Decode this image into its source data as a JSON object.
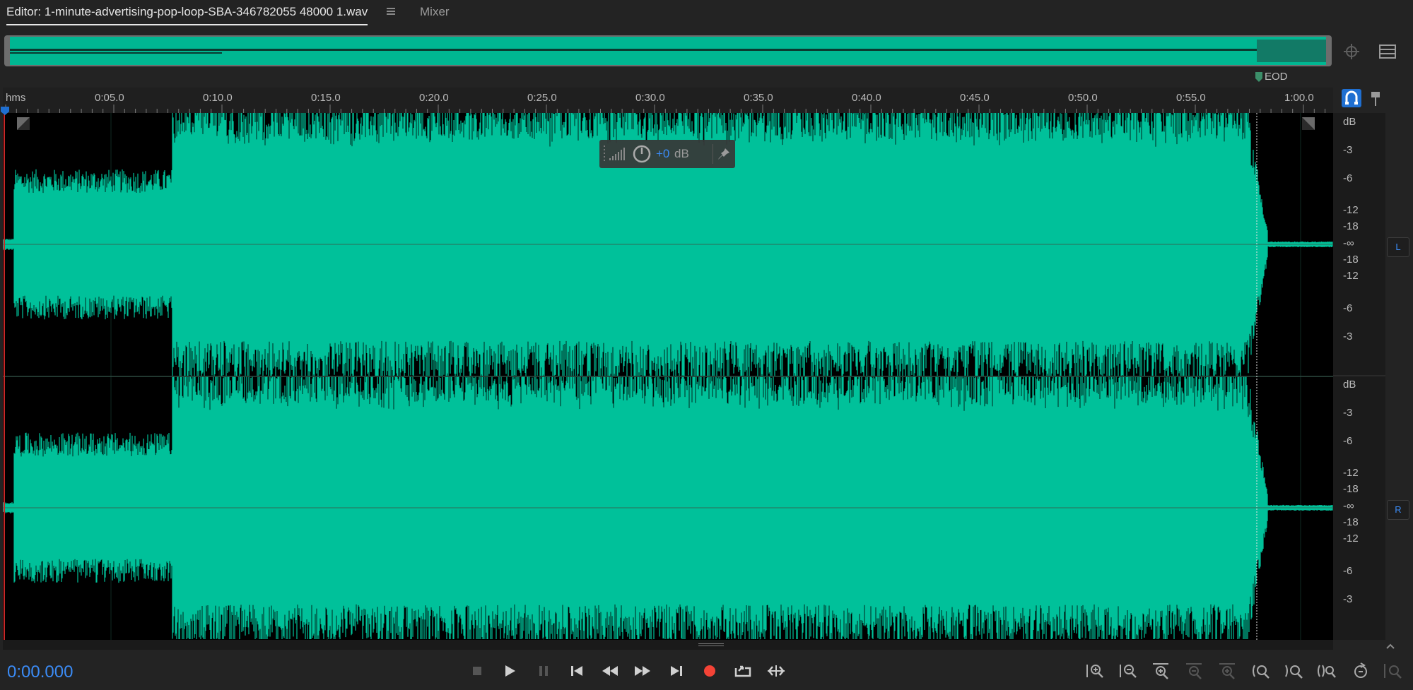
{
  "tabs": {
    "editor_label": "Editor: 1-minute-advertising-pop-loop-SBA-346782055 48000 1.wav",
    "mixer_label": "Mixer"
  },
  "ruler": {
    "unit_label": "hms",
    "ticks": [
      "0:05.0",
      "0:10.0",
      "0:15.0",
      "0:20.0",
      "0:25.0",
      "0:30.0",
      "0:35.0",
      "0:40.0",
      "0:45.0",
      "0:50.0",
      "0:55.0",
      "1:00.0"
    ],
    "eod_label": "EOD"
  },
  "hud": {
    "value": "+0",
    "unit": "dB"
  },
  "db_scale": {
    "labels": [
      "dB",
      "-3",
      "-6",
      "-12",
      "-18",
      "-∞",
      "-18",
      "-12",
      "-6",
      "-3"
    ]
  },
  "channels": {
    "left": "L",
    "right": "R"
  },
  "transport": {
    "time": "0:00.000"
  },
  "colors": {
    "waveform": "#00c19a",
    "accent": "#3b8bf5",
    "record": "#f44336",
    "background": "#000000"
  },
  "icons": {
    "transport": [
      "stop-icon",
      "play-icon",
      "pause-icon",
      "skip-to-start-icon",
      "rewind-icon",
      "fast-forward-icon",
      "skip-to-end-icon",
      "record-icon",
      "loop-icon",
      "skip-selection-icon"
    ],
    "zoom": [
      "zoom-in-amplitude-icon",
      "zoom-out-amplitude-icon",
      "zoom-in-time-icon",
      "zoom-out-time-icon",
      "zoom-out-full-icon",
      "zoom-in-left-icon",
      "zoom-in-right-icon",
      "zoom-to-selection-icon",
      "zoom-reset-icon",
      "zoom-fit-icon"
    ]
  }
}
